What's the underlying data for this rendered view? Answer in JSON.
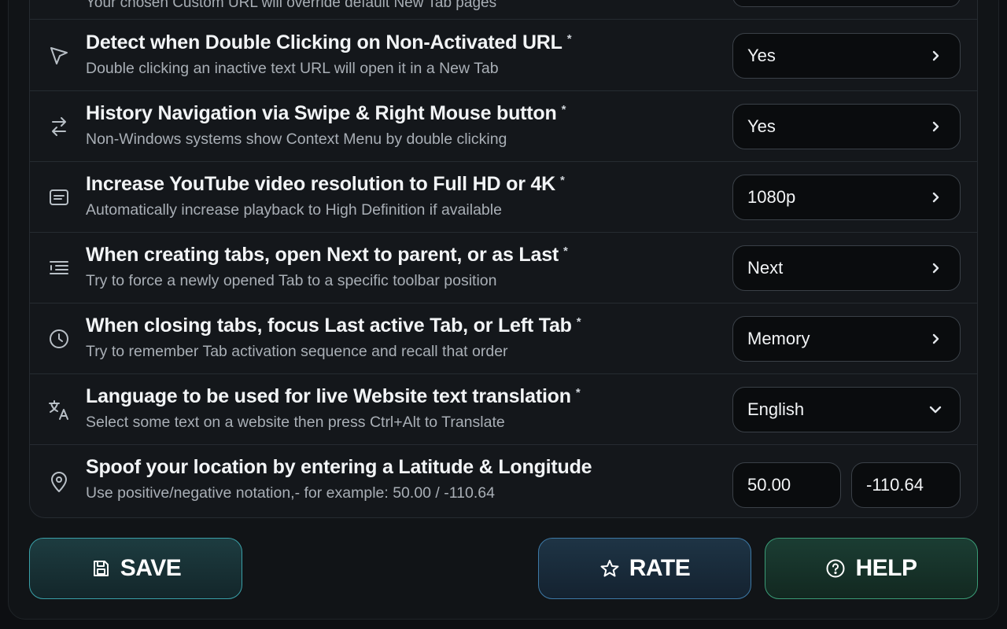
{
  "partial_row": {
    "description": "Your chosen Custom URL will override default New Tab pages"
  },
  "star": "*",
  "settings": [
    {
      "icon": "cursor-arrow-icon",
      "title": "Detect when Double Clicking on Non-Activated URL",
      "description": "Double clicking an inactive text URL will open it in a New Tab",
      "value": "Yes",
      "control": "chevron-right"
    },
    {
      "icon": "swap-arrows-icon",
      "title": "History Navigation via Swipe & Right Mouse button",
      "description": "Non-Windows systems show Context Menu by double clicking",
      "value": "Yes",
      "control": "chevron-right"
    },
    {
      "icon": "video-box-icon",
      "title": "Increase YouTube video resolution to Full HD or 4K",
      "description": "Automatically increase playback to High Definition if available",
      "value": "1080p",
      "control": "chevron-right"
    },
    {
      "icon": "indent-list-icon",
      "title": "When creating tabs, open Next to parent, or as Last",
      "description": "Try to force a newly opened Tab to a specific toolbar position",
      "value": "Next",
      "control": "chevron-right"
    },
    {
      "icon": "clock-icon",
      "title": "When closing tabs, focus Last active Tab, or Left Tab",
      "description": "Try to remember Tab activation sequence and recall that order",
      "value": "Memory",
      "control": "chevron-right"
    },
    {
      "icon": "translate-icon",
      "title": "Language to be used for live Website text translation",
      "description": "Select some text on a website then press Ctrl+Alt to Translate",
      "value": "English",
      "control": "chevron-down"
    }
  ],
  "location": {
    "icon": "map-pin-icon",
    "title": "Spoof your location by entering a Latitude & Longitude",
    "description": "Use positive/negative notation,- for example: 50.00 / -110.64",
    "latitude": "50.00",
    "longitude": "-110.64"
  },
  "buttons": {
    "save": {
      "label": "SAVE",
      "icon": "floppy-disk-icon"
    },
    "rate": {
      "label": "RATE",
      "icon": "star-outline-icon"
    },
    "help": {
      "label": "HELP",
      "icon": "question-circle-icon"
    }
  },
  "colors": {
    "background": "#0d0f12",
    "card": "#14171b",
    "save_border": "#3aa0a8",
    "rate_border": "#3d79a6",
    "help_border": "#3a9b76"
  }
}
